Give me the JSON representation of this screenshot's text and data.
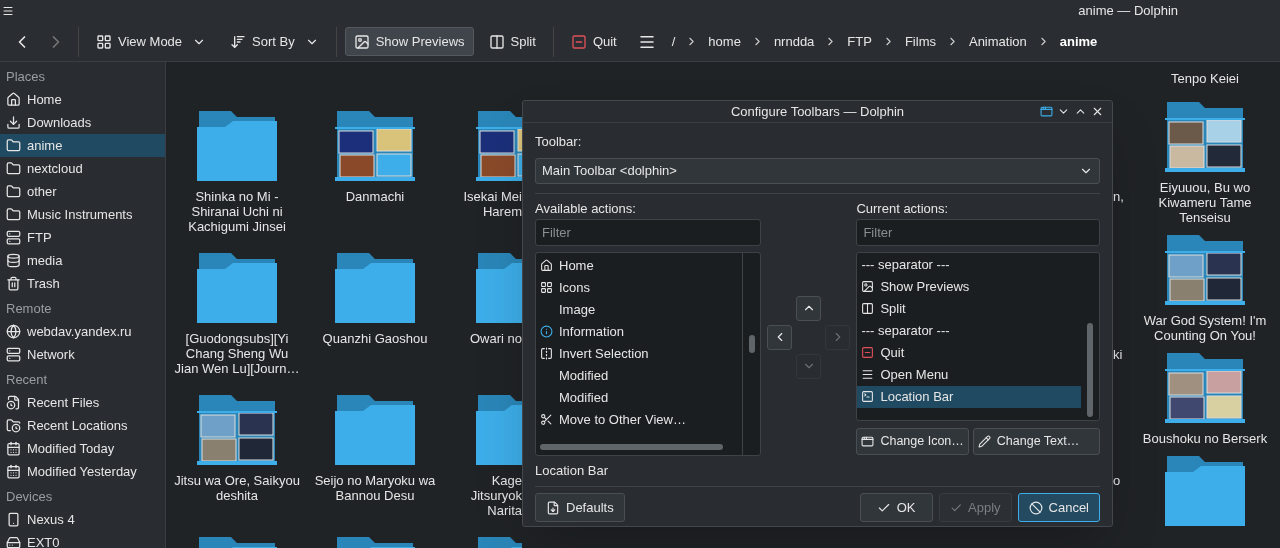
{
  "window": {
    "title": "anime — Dolphin"
  },
  "toolbar": {
    "buttons": [
      {
        "kind": "view",
        "label": "View Mode",
        "pressed": false
      },
      {
        "kind": "sort",
        "label": "Sort By",
        "pressed": false
      },
      {
        "kind": "previews",
        "label": "Show Previews",
        "pressed": true
      },
      {
        "kind": "split",
        "label": "Split",
        "pressed": false
      },
      {
        "kind": "quit",
        "label": "Quit",
        "pressed": false
      }
    ],
    "breadcrumb": [
      {
        "label": "/",
        "current": false
      },
      {
        "label": "home",
        "current": false
      },
      {
        "label": "nrndda",
        "current": false
      },
      {
        "label": "FTP",
        "current": false
      },
      {
        "label": "Films",
        "current": false
      },
      {
        "label": "Animation",
        "current": false
      },
      {
        "label": "anime",
        "current": true
      }
    ]
  },
  "sidebar": [
    {
      "title": "Places",
      "items": [
        {
          "kind": "home",
          "label": "Home",
          "selected": false
        },
        {
          "kind": "download",
          "label": "Downloads",
          "selected": false
        },
        {
          "kind": "folder",
          "label": "anime",
          "selected": true
        },
        {
          "kind": "folder",
          "label": "nextcloud",
          "selected": false
        },
        {
          "kind": "folder",
          "label": "other",
          "selected": false
        },
        {
          "kind": "folder",
          "label": "Music Instruments",
          "selected": false
        },
        {
          "kind": "server",
          "label": "FTP",
          "selected": false
        },
        {
          "kind": "disk",
          "label": "media",
          "selected": false
        },
        {
          "kind": "trash",
          "label": "Trash",
          "selected": false
        }
      ]
    },
    {
      "title": "Remote",
      "items": [
        {
          "kind": "globe",
          "label": "webdav.yandex.ru",
          "selected": false
        },
        {
          "kind": "server",
          "label": "Network",
          "selected": false
        }
      ]
    },
    {
      "title": "Recent",
      "items": [
        {
          "kind": "recent-file",
          "label": "Recent Files",
          "selected": false
        },
        {
          "kind": "recent-folder",
          "label": "Recent Locations",
          "selected": false
        },
        {
          "kind": "calendar",
          "label": "Modified Today",
          "selected": false
        },
        {
          "kind": "calendar",
          "label": "Modified Yesterday",
          "selected": false
        }
      ]
    },
    {
      "title": "Devices",
      "items": [
        {
          "kind": "phone",
          "label": "Nexus 4",
          "selected": false
        },
        {
          "kind": "drive",
          "label": "EXT0",
          "selected": false
        }
      ]
    }
  ],
  "files": {
    "columns": [
      {
        "items": [
          {
            "preview": false,
            "lines": [
              "Shinka no Mi -",
              "Shiranai Uchi ni",
              "Kachigumi Jinsei"
            ]
          },
          {
            "preview": false,
            "lines": [
              "[Guodongsubs][Yi",
              "Chang Sheng Wu",
              "Jian Wen Lu][Journ…"
            ]
          },
          {
            "preview": true,
            "lines": [
              "Jitsu wa Ore, Saikyou",
              "deshita"
            ]
          },
          {
            "preview": false
          }
        ]
      },
      {
        "items": [
          {
            "preview": true,
            "lines": [
              "Danmachi"
            ]
          },
          {
            "preview": false,
            "lines": [
              "Quanzhi Gaoshou"
            ]
          },
          {
            "preview": false,
            "lines": [
              "Seijo no Maryoku wa",
              "Bannou Desu"
            ]
          },
          {
            "preview": false
          }
        ]
      },
      {
        "items": [
          {
            "preview": true,
            "lines": [
              "Isekai Mei",
              "Harem"
            ]
          },
          {
            "preview": false,
            "lines": [
              "Owari no"
            ]
          },
          {
            "preview": false,
            "lines": [
              "Kage",
              "Jitsuryok",
              "Narita"
            ]
          },
          {
            "preview": false
          }
        ]
      }
    ],
    "fragments": [
      {
        "text": "n,"
      },
      {
        "text": "ki"
      },
      {
        "text": "o"
      }
    ],
    "last_column": {
      "top_label": "Tenpo Keiei",
      "items": [
        {
          "preview": true,
          "lines": [
            "Eiyuuou, Bu wo",
            "Kiwameru Tame",
            "Tenseisu"
          ]
        },
        {
          "preview": true,
          "lines": [
            "War God System! I'm",
            "Counting On You!"
          ]
        },
        {
          "preview": true,
          "lines": [
            "Boushoku no Berserk"
          ]
        },
        {
          "preview": false
        }
      ]
    }
  },
  "dialog": {
    "title": "Configure Toolbars — Dolphin",
    "toolbar_label": "Toolbar:",
    "toolbar_value": "Main Toolbar <dolphin>",
    "available_label": "Available actions:",
    "available_filter": {
      "placeholder": "Filter"
    },
    "available": [
      {
        "kind": "home",
        "label": "Home",
        "selected": false
      },
      {
        "kind": "icons",
        "label": "Icons",
        "selected": false
      },
      {
        "kind": "plain",
        "label": "Image",
        "selected": false
      },
      {
        "kind": "info",
        "label": "Information",
        "selected": false
      },
      {
        "kind": "invert",
        "label": "Invert Selection",
        "selected": false
      },
      {
        "kind": "plain",
        "label": "Modified",
        "selected": false
      },
      {
        "kind": "plain",
        "label": "Modified",
        "selected": false
      },
      {
        "kind": "cut",
        "label": "Move to Other View…",
        "selected": false
      }
    ],
    "current_label": "Current actions:",
    "current_filter": {
      "placeholder": "Filter"
    },
    "current": [
      {
        "kind": "plain",
        "label": "--- separator ---",
        "selected": false
      },
      {
        "kind": "previews",
        "label": "Show Previews",
        "selected": false
      },
      {
        "kind": "split",
        "label": "Split",
        "selected": false
      },
      {
        "kind": "plain",
        "label": "--- separator ---",
        "selected": false
      },
      {
        "kind": "quit",
        "label": "Quit",
        "selected": false
      },
      {
        "kind": "menu",
        "label": "Open Menu",
        "selected": false
      },
      {
        "kind": "location",
        "label": "Location Bar",
        "selected": true
      }
    ],
    "arrows": [
      {
        "kind": "up",
        "disabled": false
      },
      {
        "kind": "left",
        "disabled": false
      },
      {
        "kind": "right",
        "disabled": true
      },
      {
        "kind": "down",
        "disabled": true
      }
    ],
    "change_icon": "Change Icon…",
    "change_text": "Change Text…",
    "selected_name": "Location Bar",
    "buttons": [
      {
        "kind": "defaults",
        "label": "Defaults",
        "disabled": false,
        "default": false
      },
      {
        "kind": "ok",
        "label": "OK",
        "disabled": false,
        "default": false
      },
      {
        "kind": "apply",
        "label": "Apply",
        "disabled": true,
        "default": false
      },
      {
        "kind": "cancel",
        "label": "Cancel",
        "disabled": false,
        "default": true
      }
    ]
  }
}
